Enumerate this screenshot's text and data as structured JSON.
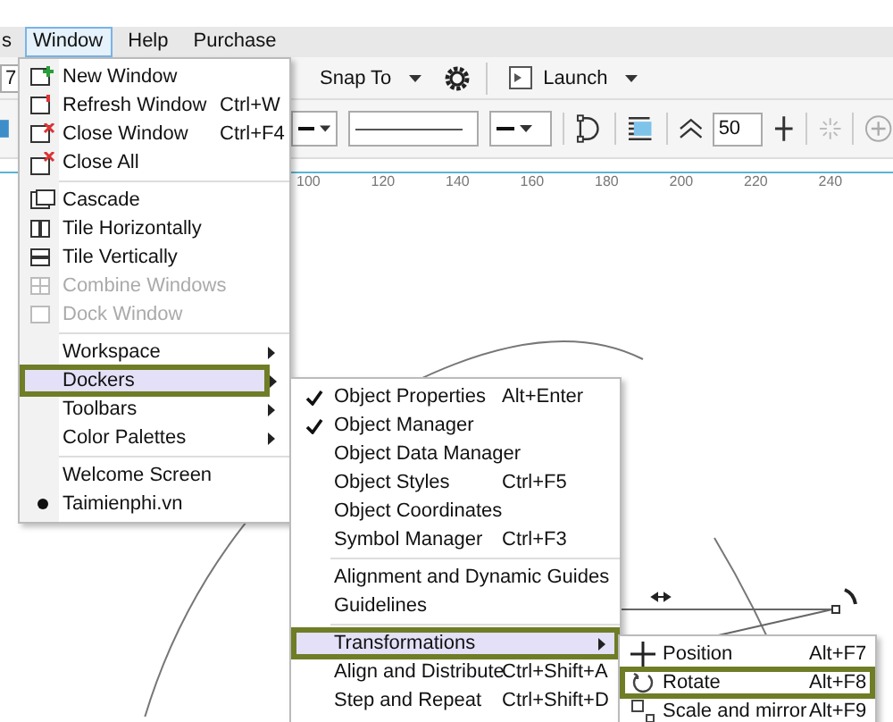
{
  "menubar": [
    {
      "label": "s",
      "selected": false
    },
    {
      "label": "Window",
      "selected": true
    },
    {
      "label": "Help",
      "selected": false
    },
    {
      "label": "Purchase",
      "selected": false
    }
  ],
  "toolbar": {
    "zoom_field": "7",
    "snap_to": "Snap To",
    "launch": "Launch",
    "size_field": "50"
  },
  "ruler": [
    "100",
    "120",
    "140",
    "160",
    "180",
    "200",
    "220",
    "240"
  ],
  "window_menu": [
    {
      "kind": "item",
      "label": "New Window",
      "disabled": false,
      "submenu": false,
      "selected": false,
      "outlined": false
    },
    {
      "kind": "item",
      "label": "Refresh Window",
      "shortcut": "Ctrl+W",
      "disabled": false,
      "submenu": false,
      "selected": false,
      "outlined": false
    },
    {
      "kind": "item",
      "label": "Close Window",
      "shortcut": "Ctrl+F4",
      "disabled": false,
      "submenu": false,
      "selected": false,
      "outlined": false
    },
    {
      "kind": "item",
      "label": "Close All",
      "disabled": false,
      "submenu": false,
      "selected": false,
      "outlined": false
    },
    {
      "kind": "separator"
    },
    {
      "kind": "item",
      "label": "Cascade",
      "disabled": false,
      "submenu": false,
      "selected": false,
      "outlined": false
    },
    {
      "kind": "item",
      "label": "Tile Horizontally",
      "disabled": false,
      "submenu": false,
      "selected": false,
      "outlined": false
    },
    {
      "kind": "item",
      "label": "Tile Vertically",
      "disabled": false,
      "submenu": false,
      "selected": false,
      "outlined": false
    },
    {
      "kind": "item",
      "label": "Combine Windows",
      "disabled": true,
      "submenu": false,
      "selected": false,
      "outlined": false
    },
    {
      "kind": "item",
      "label": "Dock Window",
      "disabled": true,
      "submenu": false,
      "selected": false,
      "outlined": false
    },
    {
      "kind": "separator"
    },
    {
      "kind": "item",
      "label": "Workspace",
      "disabled": false,
      "submenu": true,
      "selected": false,
      "outlined": false
    },
    {
      "kind": "item",
      "label": "Dockers",
      "disabled": false,
      "submenu": true,
      "selected": true,
      "outlined": true
    },
    {
      "kind": "item",
      "label": "Toolbars",
      "disabled": false,
      "submenu": true,
      "selected": false,
      "outlined": false
    },
    {
      "kind": "item",
      "label": "Color Palettes",
      "disabled": false,
      "submenu": true,
      "selected": false,
      "outlined": false
    },
    {
      "kind": "separator"
    },
    {
      "kind": "item",
      "label": "Welcome Screen",
      "disabled": false,
      "submenu": false,
      "selected": false,
      "outlined": false
    },
    {
      "kind": "item",
      "label": "Taimienphi.vn",
      "disabled": false,
      "submenu": false,
      "selected": false,
      "outlined": false,
      "active": true
    }
  ],
  "dockers_menu": [
    {
      "kind": "item",
      "label": "Object Properties",
      "shortcut": "Alt+Enter",
      "checked": true,
      "submenu": false,
      "selected": false,
      "outlined": false
    },
    {
      "kind": "item",
      "label": "Object Manager",
      "checked": true,
      "submenu": false,
      "selected": false,
      "outlined": false
    },
    {
      "kind": "item",
      "label": "Object Data Manager",
      "checked": false,
      "submenu": false,
      "selected": false,
      "outlined": false
    },
    {
      "kind": "item",
      "label": "Object Styles",
      "shortcut": "Ctrl+F5",
      "checked": false,
      "submenu": false,
      "selected": false,
      "outlined": false
    },
    {
      "kind": "item",
      "label": "Object Coordinates",
      "checked": false,
      "submenu": false,
      "selected": false,
      "outlined": false
    },
    {
      "kind": "item",
      "label": "Symbol Manager",
      "shortcut": "Ctrl+F3",
      "checked": false,
      "submenu": false,
      "selected": false,
      "outlined": false
    },
    {
      "kind": "separator"
    },
    {
      "kind": "item",
      "label": "Alignment and Dynamic Guides",
      "checked": false,
      "submenu": false,
      "selected": false,
      "outlined": false
    },
    {
      "kind": "item",
      "label": "Guidelines",
      "checked": false,
      "submenu": false,
      "selected": false,
      "outlined": false
    },
    {
      "kind": "separator"
    },
    {
      "kind": "item",
      "label": "Transformations",
      "checked": false,
      "submenu": true,
      "selected": true,
      "outlined": true
    },
    {
      "kind": "item",
      "label": "Align and Distribute",
      "shortcut": "Ctrl+Shift+A",
      "checked": false,
      "submenu": false,
      "selected": false,
      "outlined": false
    },
    {
      "kind": "item",
      "label": "Step and Repeat",
      "shortcut": "Ctrl+Shift+D",
      "checked": false,
      "submenu": false,
      "selected": false,
      "outlined": false
    }
  ],
  "transformations_menu": [
    {
      "label": "Position",
      "shortcut": "Alt+F7",
      "selected": false,
      "outlined": false
    },
    {
      "label": "Rotate",
      "shortcut": "Alt+F8",
      "selected": false,
      "outlined": true
    },
    {
      "label": "Scale and mirror",
      "shortcut": "Alt+F9",
      "selected": false,
      "outlined": false
    }
  ]
}
